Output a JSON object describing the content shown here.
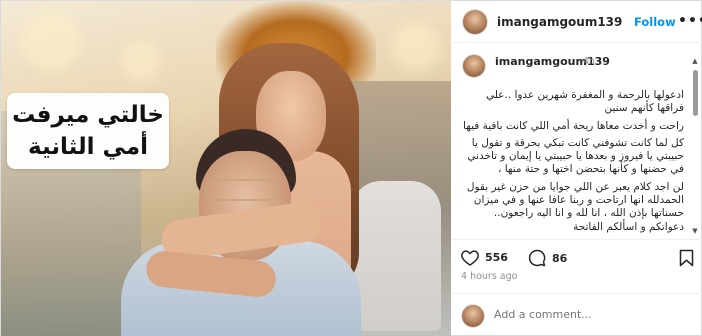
{
  "photo": {
    "overlay_line1": "خالتي ميرفت",
    "overlay_line2": "أمي الثانية"
  },
  "header": {
    "username": "imangamgoum139",
    "follow_label": "Follow",
    "more_label": "•••"
  },
  "caption": {
    "username": "imangamgoum139",
    "time": "4h",
    "paragraphs": [
      "ادعولها بالرحمة و المغفرة شهرين عدوا ..علي فراقها كأنهم سنين",
      "راحت و أخدت معاها ريحة أمي اللي كانت باقية فيها",
      "كل لما كانت تشوفني كانت تبكي بحرقة و تقول يا حبيبتي يا فيروز و بعدها يا حبيبتي يا إيمان و تاخدني في حضنها و كأنها بتحضن اختها و حتة منها ،",
      "لن اجد كلام يعبر عن اللي جوايا من حزن غير بقول الحمدلله انها ارتاحت و ربنا عافا عنها و في ميزان حسناتها بإذن الله ، انا لله و انا اليه راجعون.. دعواتكم و اسألكم الفاتحة"
    ]
  },
  "actions": {
    "likes": "556",
    "comments": "86"
  },
  "post_time": "4 hours ago",
  "comment": {
    "placeholder": "Add a comment..."
  },
  "colors": {
    "accent": "#0095f6",
    "text": "#262626",
    "muted": "#8e8e8e"
  },
  "icons": [
    "heart-icon",
    "comment-icon",
    "bookmark-icon",
    "more-icon",
    "scroll-up-icon",
    "scroll-down-icon"
  ]
}
